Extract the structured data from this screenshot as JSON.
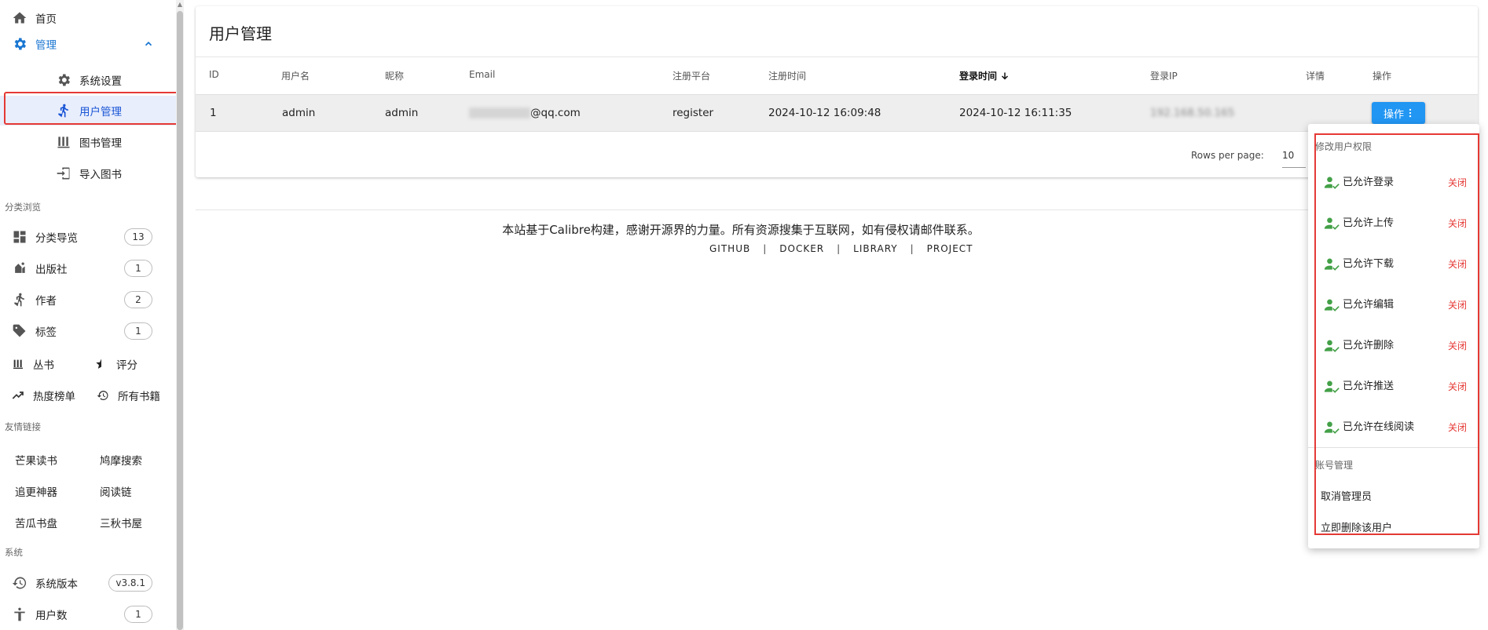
{
  "sidebar": {
    "home": "首页",
    "admin": "管理",
    "admin_sub": [
      "系统设置",
      "用户管理",
      "图书管理",
      "导入图书"
    ],
    "browse_header": "分类浏览",
    "browse_items": [
      {
        "label": "分类导览",
        "count": "13"
      },
      {
        "label": "出版社",
        "count": "1"
      },
      {
        "label": "作者",
        "count": "2"
      },
      {
        "label": "标签",
        "count": "1"
      }
    ],
    "pair1": [
      "丛书",
      "评分"
    ],
    "pair2": [
      "热度榜单",
      "所有书籍"
    ],
    "friends_header": "友情链接",
    "friends": [
      "芒果读书",
      "鸠摩搜索",
      "追更神器",
      "阅读链",
      "苦瓜书盘",
      "三秋书屋"
    ],
    "system_header": "系统",
    "version_label": "系统版本",
    "version": "v3.8.1",
    "users_label": "用户数",
    "users_count": "1"
  },
  "page": {
    "title": "用户管理",
    "columns": [
      "ID",
      "用户名",
      "昵称",
      "Email",
      "注册平台",
      "注册时间",
      "登录时间",
      "登录IP",
      "详情",
      "操作"
    ],
    "row": {
      "id": "1",
      "username": "admin",
      "nickname": "admin",
      "email_suffix": "@qq.com",
      "platform": "register",
      "reg_time": "2024-10-12 16:09:48",
      "login_time": "2024-10-12 16:11:35",
      "ip": "192.168.50.165",
      "op_label": "操作"
    },
    "rows_per_page_label": "Rows per page:",
    "rows_per_page": "10"
  },
  "footer": {
    "text": "本站基于Calibre构建，感谢开源界的力量。所有资源搜集于互联网，如有侵权请邮件联系。",
    "links": [
      "GITHUB",
      "DOCKER",
      "LIBRARY",
      "PROJECT"
    ]
  },
  "menu": {
    "perm_header": "修改用户权限",
    "perms": [
      "已允许登录",
      "已允许上传",
      "已允许下载",
      "已允许编辑",
      "已允许删除",
      "已允许推送",
      "已允许在线阅读"
    ],
    "close_label": "关闭",
    "account_header": "账号管理",
    "actions": [
      "取消管理员",
      "立即删除该用户"
    ]
  },
  "colors": {
    "accent": "#2196f3",
    "admin_blue": "#1976d2",
    "danger": "#e53935",
    "allowed_green": "#43a047"
  }
}
